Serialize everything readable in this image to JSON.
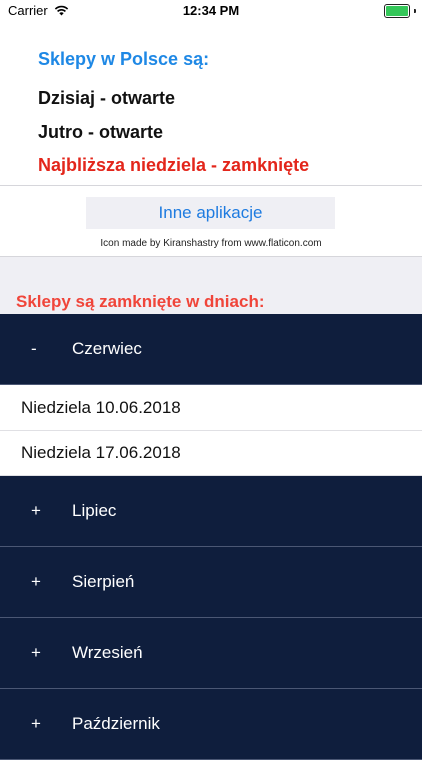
{
  "status_bar": {
    "carrier": "Carrier",
    "time": "12:34 PM",
    "battery_level": 1.0,
    "icons": [
      "wifi-icon",
      "battery-icon"
    ]
  },
  "info": {
    "title": "Sklepy w Polsce są:",
    "today": "Dzisiaj - otwarte",
    "tomorrow": "Jutro  - otwarte",
    "next_sunday": "Najbliższa niedziela - zamknięte"
  },
  "apps_button_label": "Inne aplikacje",
  "credit": "Icon made by Kiranshastry from www.flaticon.com",
  "closed_heading": "Sklepy są zamknięte w dniach:",
  "months": [
    {
      "sign": "-",
      "label": "Czerwiec",
      "expanded": true,
      "dates": [
        "Niedziela 10.06.2018",
        "Niedziela 17.06.2018"
      ]
    },
    {
      "sign": "+",
      "label": "Lipiec",
      "expanded": false
    },
    {
      "sign": "+",
      "label": "Sierpień",
      "expanded": false
    },
    {
      "sign": "+",
      "label": "Wrzesień",
      "expanded": false
    },
    {
      "sign": "+",
      "label": "Październik",
      "expanded": false
    }
  ],
  "colors": {
    "accent_blue": "#1e88e5",
    "closed_red": "#e3261b",
    "heading_red": "#f0453a",
    "navy": "#0f1e3d",
    "battery_green": "#34c759"
  }
}
